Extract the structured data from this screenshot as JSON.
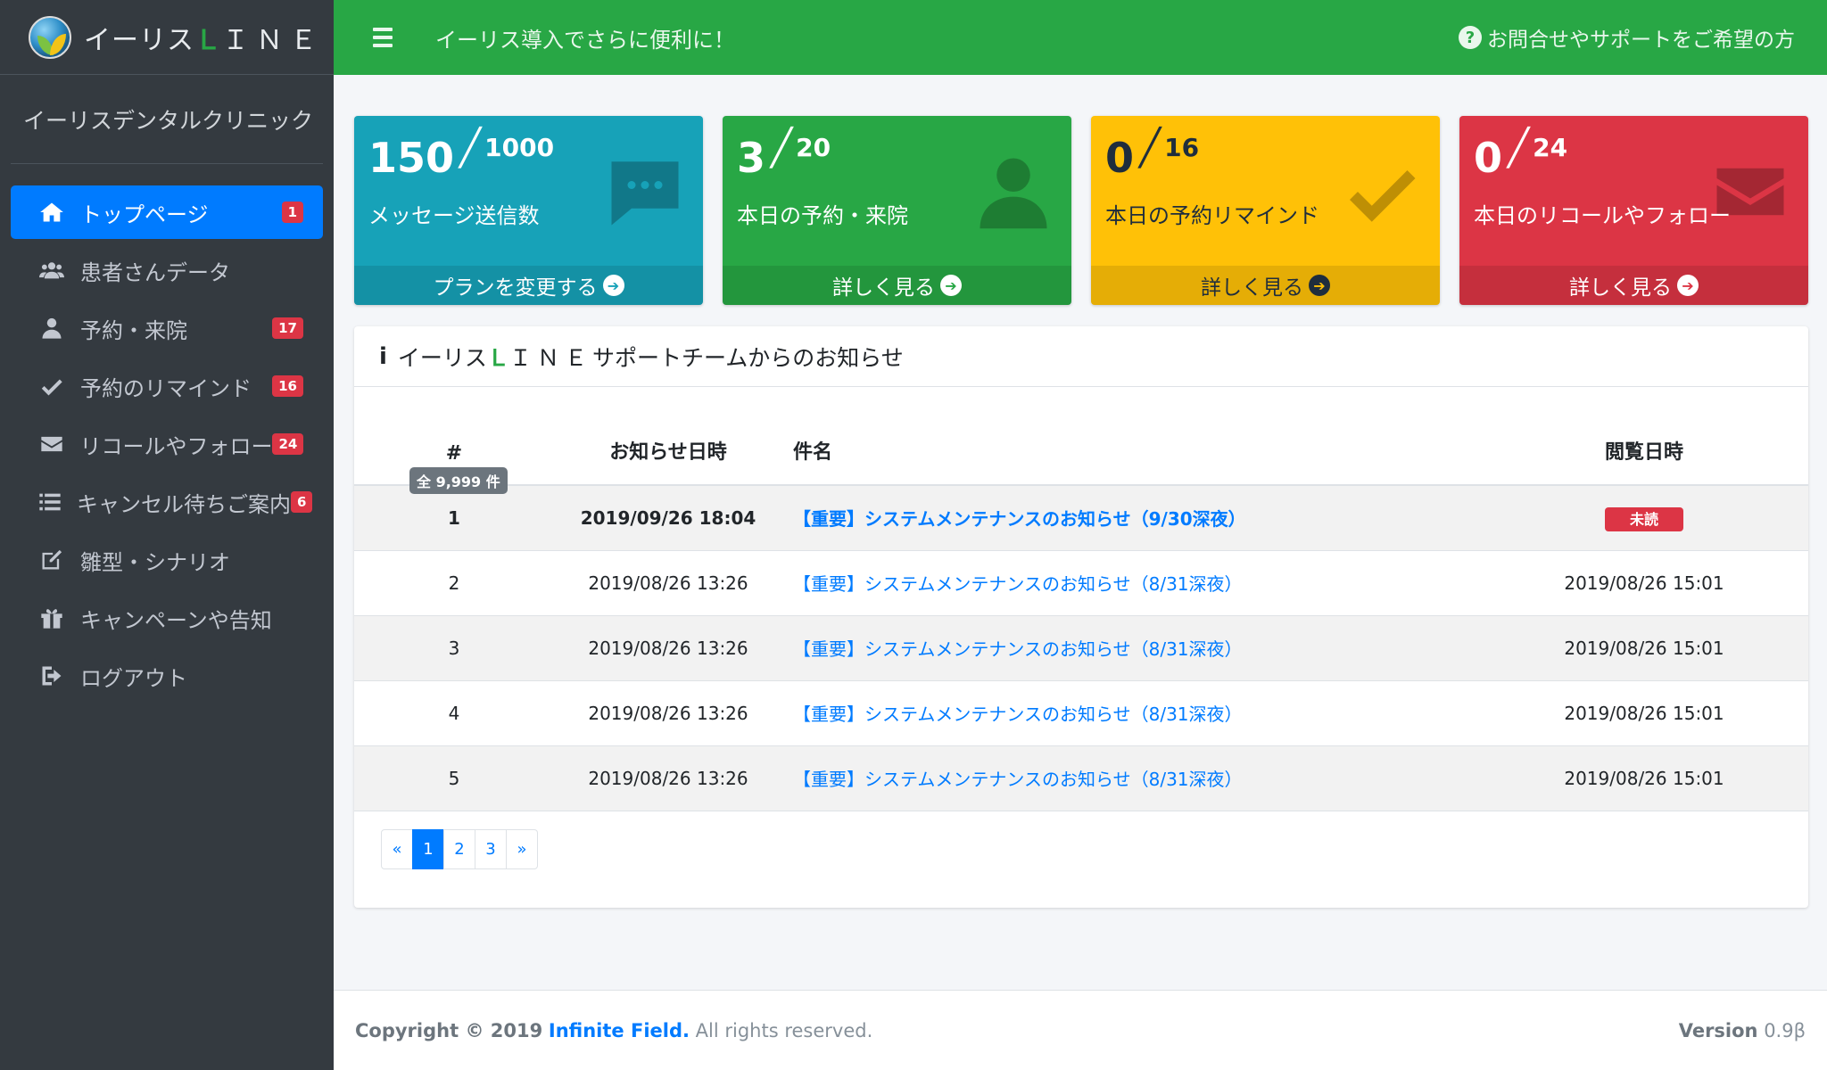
{
  "brand": {
    "name_prefix": "イーリス",
    "name_l": "Ｌ",
    "name_suffix": "ＩＮＥ"
  },
  "clinic_name": "イーリスデンタルクリニック",
  "sidebar": {
    "items": [
      {
        "label": "トップページ",
        "icon": "home-icon",
        "badge": "1",
        "active": true
      },
      {
        "label": "患者さんデータ",
        "icon": "users-icon",
        "badge": ""
      },
      {
        "label": "予約・来院",
        "icon": "user-icon",
        "badge": "17"
      },
      {
        "label": "予約のリマインド",
        "icon": "check-icon",
        "badge": "16"
      },
      {
        "label": "リコールやフォロー",
        "icon": "envelope-icon",
        "badge": "24"
      },
      {
        "label": "キャンセル待ちご案内",
        "icon": "list-icon",
        "badge": "6"
      },
      {
        "label": "雛型・シナリオ",
        "icon": "edit-icon",
        "badge": ""
      },
      {
        "label": "キャンペーンや告知",
        "icon": "gift-icon",
        "badge": ""
      },
      {
        "label": "ログアウト",
        "icon": "sign-out-icon",
        "badge": ""
      }
    ]
  },
  "header": {
    "title": "イーリス導入でさらに便利に！",
    "help": "お問合せやサポートをご希望の方"
  },
  "boxes": [
    {
      "value": "150",
      "total": "1000",
      "label": "メッセージ送信数",
      "link": "プランを変更する",
      "color": "#17a2b8",
      "icon": "comment-icon"
    },
    {
      "value": "3",
      "total": "20",
      "label": "本日の予約・来院",
      "link": "詳しく見る",
      "color": "#28a745",
      "icon": "user-icon"
    },
    {
      "value": "0",
      "total": "16",
      "label": "本日の予約リマインド",
      "link": "詳しく見る",
      "color": "#ffc107",
      "icon": "check-icon"
    },
    {
      "value": "0",
      "total": "24",
      "label": "本日のリコールやフォロー",
      "link": "詳しく見る",
      "color": "#dc3545",
      "icon": "envelope-icon"
    }
  ],
  "notices": {
    "title_prefix": "イーリス",
    "title_l": "Ｌ",
    "title_ine": "ＩＮＥ",
    "title_suffix": "サポートチームからのお知らせ",
    "total_badge": "全 9,999 件",
    "columns": {
      "num": "#",
      "date": "お知らせ日時",
      "subject": "件名",
      "viewed": "閲覧日時"
    },
    "rows": [
      {
        "num": "1",
        "date": "2019/09/26 18:04",
        "subject": "【重要】システムメンテナンスのお知らせ（9/30深夜）",
        "viewed": "未読",
        "unread": true
      },
      {
        "num": "2",
        "date": "2019/08/26 13:26",
        "subject": "【重要】システムメンテナンスのお知らせ（8/31深夜）",
        "viewed": "2019/08/26 15:01",
        "unread": false
      },
      {
        "num": "3",
        "date": "2019/08/26 13:26",
        "subject": "【重要】システムメンテナンスのお知らせ（8/31深夜）",
        "viewed": "2019/08/26 15:01",
        "unread": false
      },
      {
        "num": "4",
        "date": "2019/08/26 13:26",
        "subject": "【重要】システムメンテナンスのお知らせ（8/31深夜）",
        "viewed": "2019/08/26 15:01",
        "unread": false
      },
      {
        "num": "5",
        "date": "2019/08/26 13:26",
        "subject": "【重要】システムメンテナンスのお知らせ（8/31深夜）",
        "viewed": "2019/08/26 15:01",
        "unread": false
      }
    ],
    "pagination": {
      "prev": "«",
      "pages": [
        "1",
        "2",
        "3"
      ],
      "next": "»",
      "current": "1"
    }
  },
  "footer": {
    "copyright": "Copyright © 2019",
    "company": "Infinite Field.",
    "rights": "All rights reserved.",
    "version_label": "Version",
    "version": "0.9β"
  },
  "colors": {
    "primary": "#007bff",
    "success": "#28a745",
    "sidebar": "#343a40",
    "danger": "#dc3545"
  }
}
